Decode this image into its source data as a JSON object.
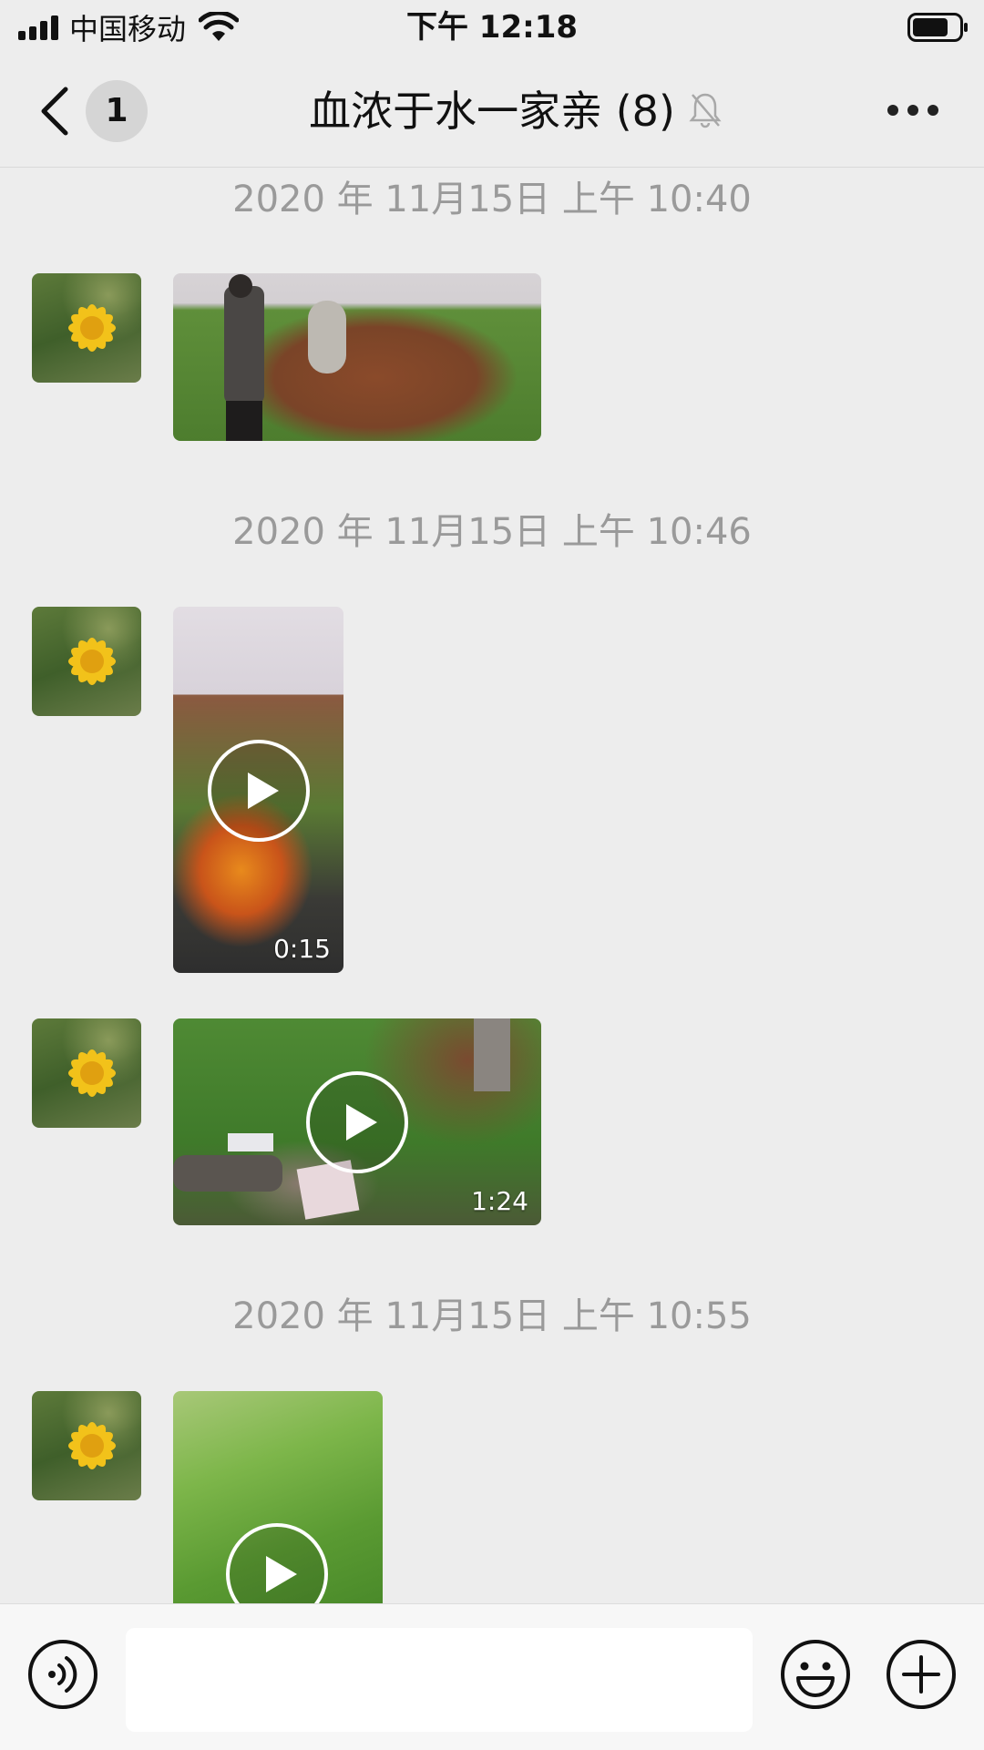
{
  "statusbar": {
    "carrier": "中国移动",
    "time": "下午 12:18"
  },
  "navbar": {
    "unread_count": "1",
    "title": "血浓于水一家亲 (8)",
    "back_icon": "chevron-left-icon",
    "mute_icon": "bell-muted-icon",
    "more_icon": "more-dots-icon"
  },
  "messages": [
    {
      "timestamp": "2020 年 11月15日 上午 10:40",
      "items": [
        {
          "type": "photo"
        }
      ]
    },
    {
      "timestamp": "2020 年 11月15日 上午 10:46",
      "items": [
        {
          "type": "video",
          "duration": "0:15"
        },
        {
          "type": "video",
          "duration": "1:24"
        }
      ]
    },
    {
      "timestamp": "2020 年 11月15日 上午 10:55",
      "items": [
        {
          "type": "video"
        }
      ]
    }
  ],
  "inputbar": {
    "voice_icon": "voice-icon",
    "emoji_icon": "emoji-icon",
    "plus_icon": "plus-icon",
    "text": ""
  },
  "colors": {
    "background": "#ededed",
    "timestamp": "#9a9a9a",
    "avatar_flower": "#f2c21a"
  }
}
